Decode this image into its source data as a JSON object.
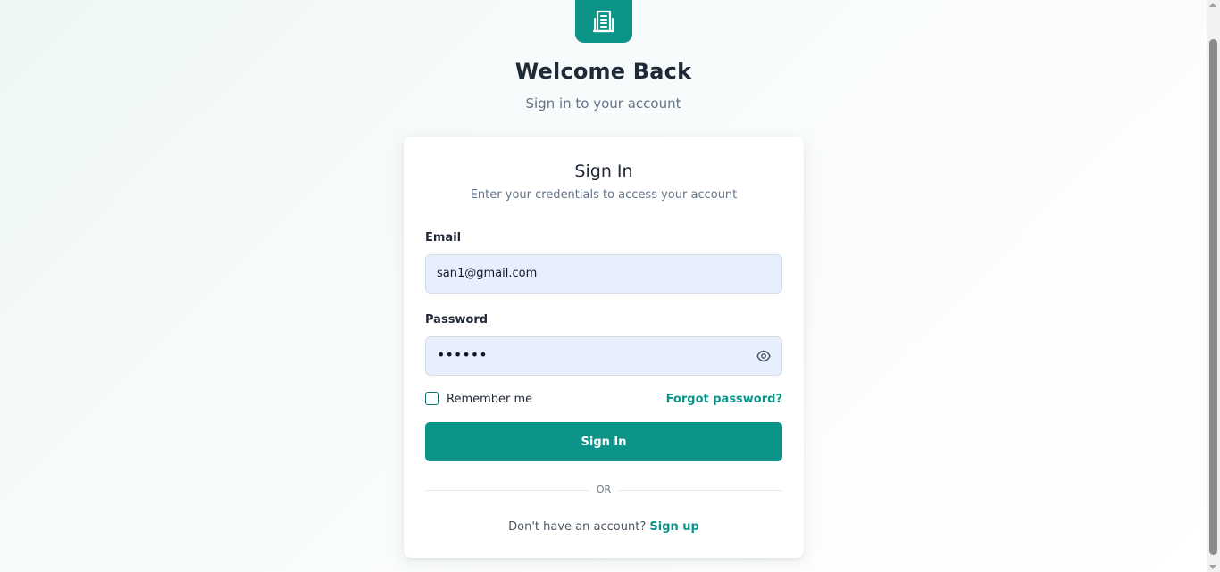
{
  "header": {
    "title": "Welcome Back",
    "subtitle": "Sign in to your account",
    "logo_icon": "building-icon"
  },
  "card": {
    "title": "Sign In",
    "subtitle": "Enter your credentials to access your account",
    "email": {
      "label": "Email",
      "value": "san1@gmail.com"
    },
    "password": {
      "label": "Password",
      "masked_value": "••••••",
      "toggle_icon": "eye-icon"
    },
    "remember_label": "Remember me",
    "remember_checked": false,
    "forgot_label": "Forgot password?",
    "submit_label": "Sign In",
    "divider_text": "OR",
    "signup_prompt": "Don't have an account?",
    "signup_label": "Sign up"
  },
  "colors": {
    "accent": "#0d9488",
    "input_bg": "#e8effc",
    "text": "#1f2937",
    "muted": "#64748b"
  }
}
